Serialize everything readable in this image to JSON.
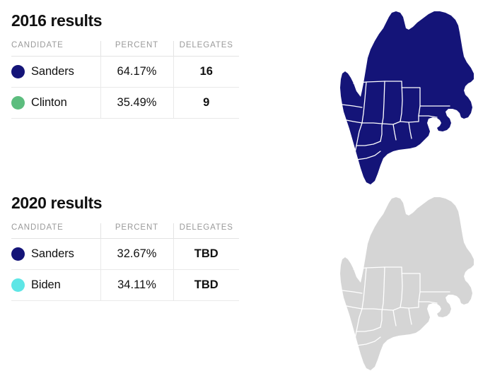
{
  "colors": {
    "sanders": "#141478",
    "clinton": "#5cbd7e",
    "biden": "#5ee6e6",
    "map_filled": "#141478",
    "map_empty": "#d5d5d5",
    "map_border": "#ffffff",
    "header_text": "#9a9a9a",
    "body_text": "#111111",
    "rule": "#e5e5e5"
  },
  "sections": [
    {
      "id": "2016",
      "title": "2016 results",
      "columns": [
        "CANDIDATE",
        "PERCENT",
        "DELEGATES"
      ],
      "rows": [
        {
          "candidate": "Sanders",
          "percent": "64.17%",
          "delegates": "16",
          "dot": "sanders-dot",
          "color": "#141478"
        },
        {
          "candidate": "Clinton",
          "percent": "35.49%",
          "delegates": "9",
          "dot": "clinton-dot",
          "color": "#5cbd7e"
        }
      ],
      "map": {
        "name": "maine-map-2016",
        "state": "Maine",
        "fill": "#141478",
        "status": "called"
      }
    },
    {
      "id": "2020",
      "title": "2020 results",
      "columns": [
        "CANDIDATE",
        "PERCENT",
        "DELEGATES"
      ],
      "rows": [
        {
          "candidate": "Sanders",
          "percent": "32.67%",
          "delegates": "TBD",
          "dot": "sanders-dot",
          "color": "#141478"
        },
        {
          "candidate": "Biden",
          "percent": "34.11%",
          "delegates": "TBD",
          "dot": "biden-dot",
          "color": "#5ee6e6"
        }
      ],
      "map": {
        "name": "maine-map-2020",
        "state": "Maine",
        "fill": "#d5d5d5",
        "status": "uncalled"
      }
    }
  ]
}
